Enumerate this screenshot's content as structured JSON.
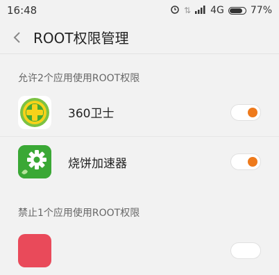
{
  "status": {
    "time": "16:48",
    "network": "4G",
    "battery": "77%",
    "icons": [
      "alarm-icon",
      "vibrate-icon",
      "signal-icon",
      "battery-icon"
    ]
  },
  "header": {
    "title": "ROOT权限管理"
  },
  "allowed": {
    "label": "允许2个应用使用ROOT权限",
    "items": [
      {
        "name": "360卫士",
        "icon": "360-security-icon",
        "enabled": true
      },
      {
        "name": "烧饼加速器",
        "icon": "shaobing-accelerator-icon",
        "enabled": true
      }
    ]
  },
  "denied": {
    "label": "禁止1个应用使用ROOT权限"
  },
  "colors": {
    "accent": "#ee7a1c",
    "background": "#f2f2f2"
  }
}
